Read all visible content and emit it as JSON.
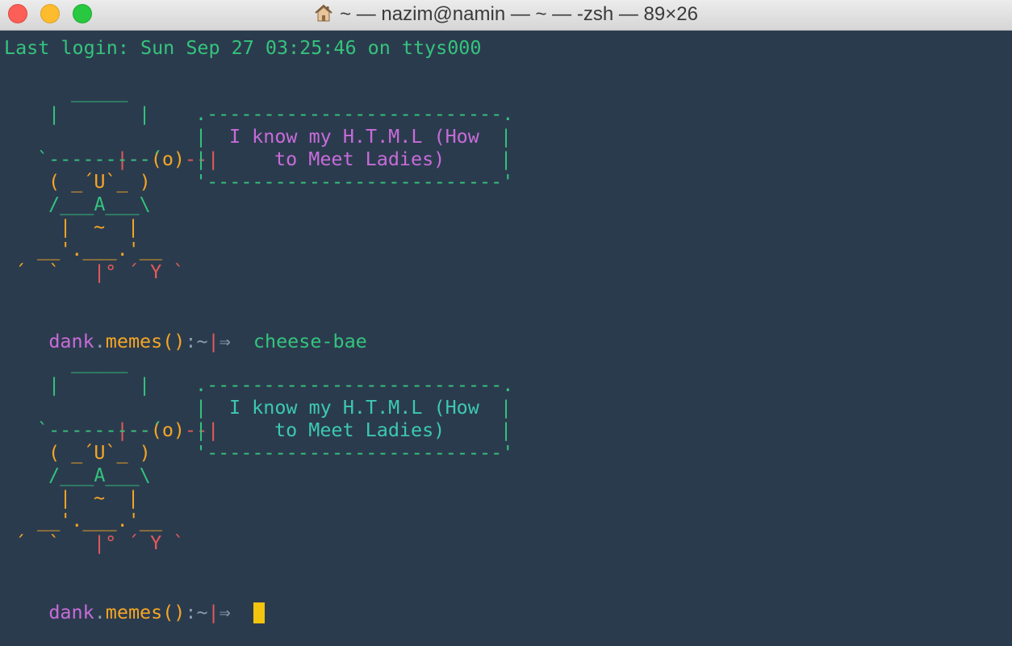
{
  "window": {
    "title": "~ — nazim@namin — ~ — -zsh — 89×26"
  },
  "colors": {
    "background": "#2b3b4e",
    "green": "#34c47c",
    "yellow": "#f5a623",
    "purple": "#c76cd9",
    "red": "#e45a5a",
    "gray": "#8a9bb0",
    "cursor": "#f2c40f",
    "teal": "#3cc9b0"
  },
  "terminal": {
    "last_login": "Last login: Sun Sep 27 03:25:46 on ttys000",
    "prompt": {
      "user": "dank",
      "dot": ".",
      "host": "memes()",
      "colon": ":",
      "path": "~",
      "bar": "|",
      "arrow": "⇒",
      "command": "cheese-bae"
    },
    "art": {
      "hat_top": "_____",
      "hat_side_left": "|",
      "hat_side_right": "|",
      "band_left": "|--",
      "band_center": "(o)",
      "band_right": "--|",
      "brim": "`---------´",
      "face": "( _´U`_ )",
      "chin": "/___A___\\",
      "body_left": "|",
      "body_mid": "~",
      "body_right": "|",
      "legs": "__'.___.'__",
      "feet_left": "´  `",
      "feet_mid": "|°",
      "feet_right": "´ Y `"
    },
    "bubble": {
      "top": ".--------------------------.",
      "line1": "I know my H.T.M.L (How",
      "line2": "to Meet Ladies)",
      "bottom": "'--------------------------'",
      "edge": "|"
    }
  }
}
